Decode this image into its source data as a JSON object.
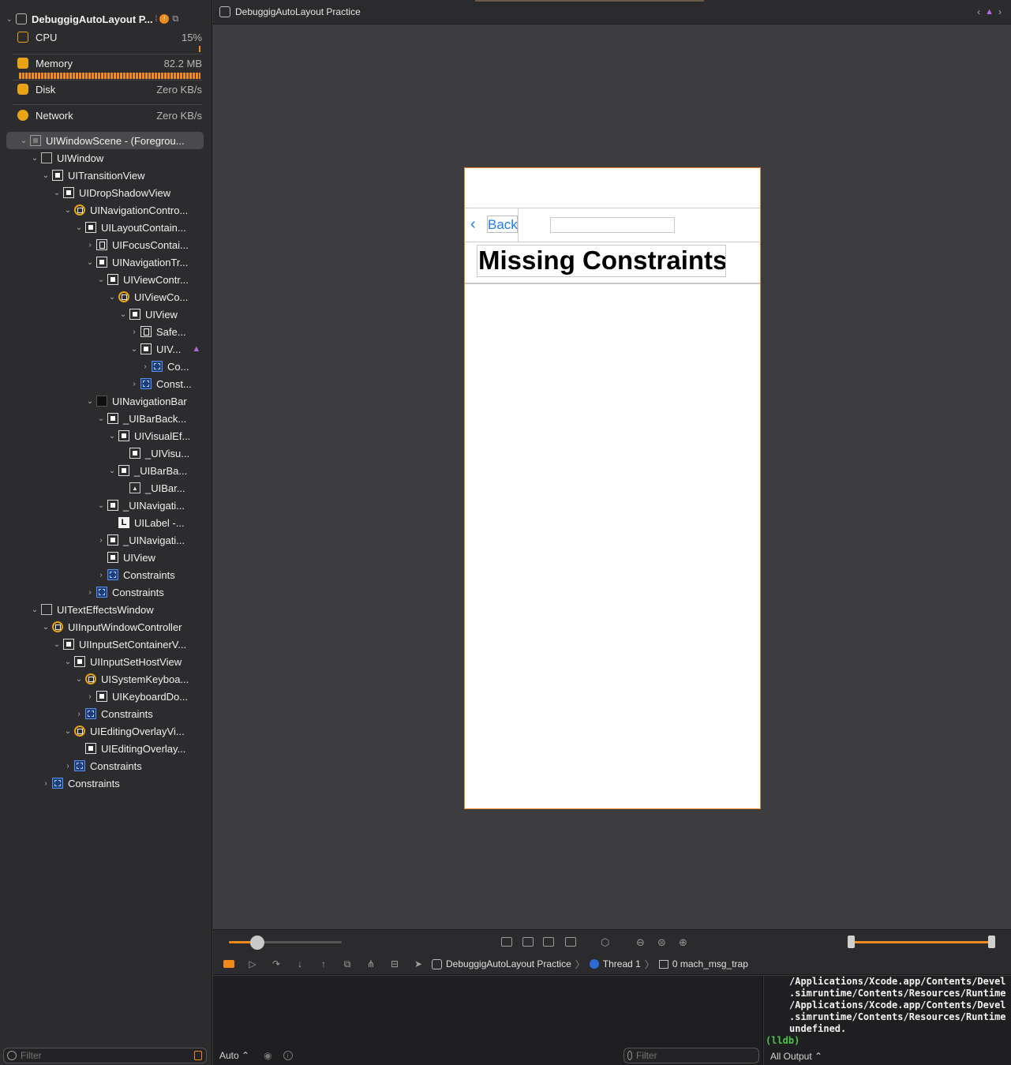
{
  "process": {
    "name": "DebuggigAutoLayout P...",
    "gauges": [
      {
        "label": "CPU",
        "value": "15%"
      },
      {
        "label": "Memory",
        "value": "82.2 MB"
      },
      {
        "label": "Disk",
        "value": "Zero KB/s"
      },
      {
        "label": "Network",
        "value": "Zero KB/s"
      }
    ],
    "colors": {
      "accent": "#f08a1c",
      "cpu": "#e8a316"
    }
  },
  "tree": [
    {
      "label": "UIWindowScene - (Foregrou...",
      "icon": "scene-icon"
    },
    {
      "label": "UIWindow",
      "icon": "window-icon"
    },
    {
      "label": "UITransitionView",
      "icon": "view-icon"
    },
    {
      "label": "UIDropShadowView",
      "icon": "view-icon"
    },
    {
      "label": "UINavigationContro...",
      "icon": "navigation-controller-icon"
    },
    {
      "label": "UILayoutContain...",
      "icon": "view-icon"
    },
    {
      "label": "UIFocusContai...",
      "icon": "focus-container-icon"
    },
    {
      "label": "UINavigationTr...",
      "icon": "view-icon"
    },
    {
      "label": "UIViewContr...",
      "icon": "view-icon"
    },
    {
      "label": "UIViewCo...",
      "icon": "view-controller-icon"
    },
    {
      "label": "UIView",
      "icon": "view-icon"
    },
    {
      "label": "Safe...",
      "icon": "focus-container-icon"
    },
    {
      "label": "UIV...",
      "icon": "view-icon"
    },
    {
      "label": "Co...",
      "icon": "constraints-icon"
    },
    {
      "label": "Const...",
      "icon": "constraints-icon"
    },
    {
      "label": "UINavigationBar",
      "icon": "navigation-bar-icon"
    },
    {
      "label": "_UIBarBack...",
      "icon": "view-icon"
    },
    {
      "label": "UIVisualEf...",
      "icon": "view-icon"
    },
    {
      "label": "_UIVisu...",
      "icon": "view-icon"
    },
    {
      "label": "_UIBarBa...",
      "icon": "view-icon"
    },
    {
      "label": "_UIBar...",
      "icon": "image-view-icon"
    },
    {
      "label": "_UINavigati...",
      "icon": "view-icon"
    },
    {
      "label": "UILabel -...",
      "icon": "label-icon"
    },
    {
      "label": "_UINavigati...",
      "icon": "view-icon"
    },
    {
      "label": "UIView",
      "icon": "view-icon"
    },
    {
      "label": "Constraints",
      "icon": "constraints-icon"
    },
    {
      "label": "Constraints",
      "icon": "constraints-icon"
    },
    {
      "label": "UITextEffectsWindow",
      "icon": "window-icon"
    },
    {
      "label": "UIInputWindowController",
      "icon": "view-controller-icon"
    },
    {
      "label": "UIInputSetContainerV...",
      "icon": "view-icon"
    },
    {
      "label": "UIInputSetHostView",
      "icon": "view-icon"
    },
    {
      "label": "UISystemKeyboa...",
      "icon": "view-controller-icon"
    },
    {
      "label": "UIKeyboardDo...",
      "icon": "view-icon"
    },
    {
      "label": "Constraints",
      "icon": "constraints-icon"
    },
    {
      "label": "UIEditingOverlayVi...",
      "icon": "view-controller-icon"
    },
    {
      "label": "UIEditingOverlay...",
      "icon": "view-icon"
    },
    {
      "label": "Constraints",
      "icon": "constraints-icon"
    },
    {
      "label": "Constraints",
      "icon": "constraints-icon"
    }
  ],
  "navigator_filter": {
    "placeholder": "Filter"
  },
  "topbar": {
    "title": "DebuggigAutoLayout Practice"
  },
  "device": {
    "back_label": "Back",
    "heading": "Missing Constraints"
  },
  "canvas_bar": {
    "spacing_fraction": 0.25
  },
  "debug_bar": {
    "crumbs": [
      "DebuggigAutoLayout Practice",
      "Thread 1",
      "0 mach_msg_trap"
    ]
  },
  "variables": {
    "scope": "Auto ⌃",
    "filter_placeholder": "Filter"
  },
  "console": {
    "lines": [
      "/Applications/Xcode.app/Contents/Devel",
      ".simruntime/Contents/Resources/Runtime",
      "/Applications/Xcode.app/Contents/Devel",
      ".simruntime/Contents/Resources/Runtime",
      "undefined."
    ],
    "prompt": "(lldb)",
    "output_filter": "All Output ⌃"
  }
}
